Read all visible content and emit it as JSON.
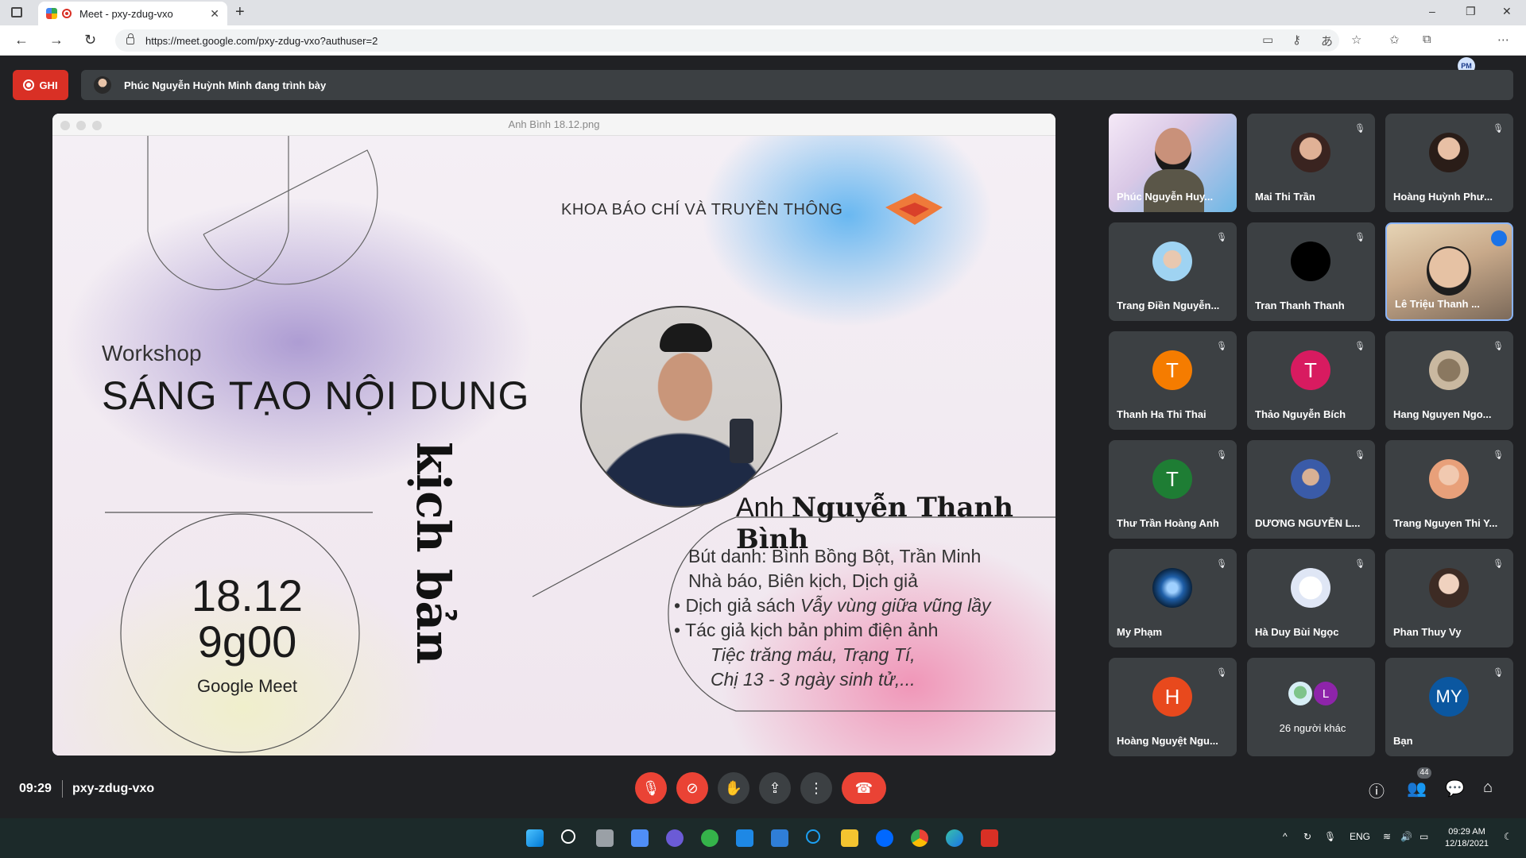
{
  "browser": {
    "tab_title": "Meet - pxy-zdug-vxo",
    "tab_close": "✕",
    "new_tab": "+",
    "url": "https://meet.google.com/pxy-zdug-vxo?authuser=2",
    "profile_initials": "PM",
    "window_controls": [
      "–",
      "❐",
      "✕"
    ]
  },
  "meet": {
    "record_label": "GHI",
    "presenting_text": "Phúc Nguyễn Huỳnh Minh đang trình bày",
    "slide": {
      "window_title": "Anh Bình 18.12.png",
      "faculty": "KHOA BÁO CHÍ VÀ TRUYỀN THÔNG",
      "workshop": "Workshop",
      "title": "SÁNG TẠO NỘI DUNG",
      "vertical_title": "kịch bản",
      "date": "18.12",
      "time": "9g00",
      "platform": "Google Meet",
      "speaker_prefix": "Anh",
      "speaker_name": "Nguyễn Thanh Bình",
      "bio_line1": "Bút danh: Bình Bồng Bột, Trần Minh",
      "bio_line2": "Nhà báo, Biên kịch, Dịch giả",
      "bullet1_prefix": "• Dịch giả sách",
      "bullet1_book": "Vẫy vùng giữa vũng lầy",
      "bullet2": "• Tác giả kịch bản phim điện ảnh",
      "films_line1": "Tiệc trăng máu, Trạng Tí,",
      "films_line2": "Chị 13 - 3 ngày sinh tử,..."
    },
    "participants": [
      {
        "name": "Phúc Nguyễn Huy...",
        "type": "video"
      },
      {
        "name": "Mai Thi Trần",
        "type": "photo"
      },
      {
        "name": "Hoàng Huỳnh Phư...",
        "type": "photo"
      },
      {
        "name": "Trang Điền Nguyễn...",
        "type": "photo"
      },
      {
        "name": "Tran Thanh Thanh",
        "type": "photo"
      },
      {
        "name": "Lê Triệu Thanh ...",
        "type": "video"
      },
      {
        "name": "Thanh Ha Thi Thai",
        "initial": "T",
        "color": "#f57c00"
      },
      {
        "name": "Thảo Nguyễn Bích",
        "initial": "T",
        "color": "#d81b60"
      },
      {
        "name": "Hang Nguyen Ngo...",
        "type": "photo"
      },
      {
        "name": "Thư Trần Hoàng Anh",
        "initial": "T",
        "color": "#1e7d34"
      },
      {
        "name": "DƯƠNG NGUYỄN L...",
        "type": "photo"
      },
      {
        "name": "Trang Nguyen Thi Y...",
        "type": "photo"
      },
      {
        "name": "My Phạm",
        "type": "photo"
      },
      {
        "name": "Hà Duy Bùi Ngọc",
        "type": "photo"
      },
      {
        "name": "Phan Thuy Vy",
        "type": "photo"
      },
      {
        "name": "Hoàng Nguyệt Ngu...",
        "initial": "H",
        "color": "#e8491d"
      },
      {
        "name": "26 người khác",
        "initial": "L",
        "color": "#8e24aa"
      },
      {
        "name": "Bạn",
        "initial": "MY",
        "color": "#0b57a0"
      }
    ],
    "clock": "09:29",
    "meeting_code": "pxy-zdug-vxo",
    "participant_count": "44"
  },
  "taskbar": {
    "lang": "ENG",
    "time": "09:29 AM",
    "date": "12/18/2021"
  }
}
